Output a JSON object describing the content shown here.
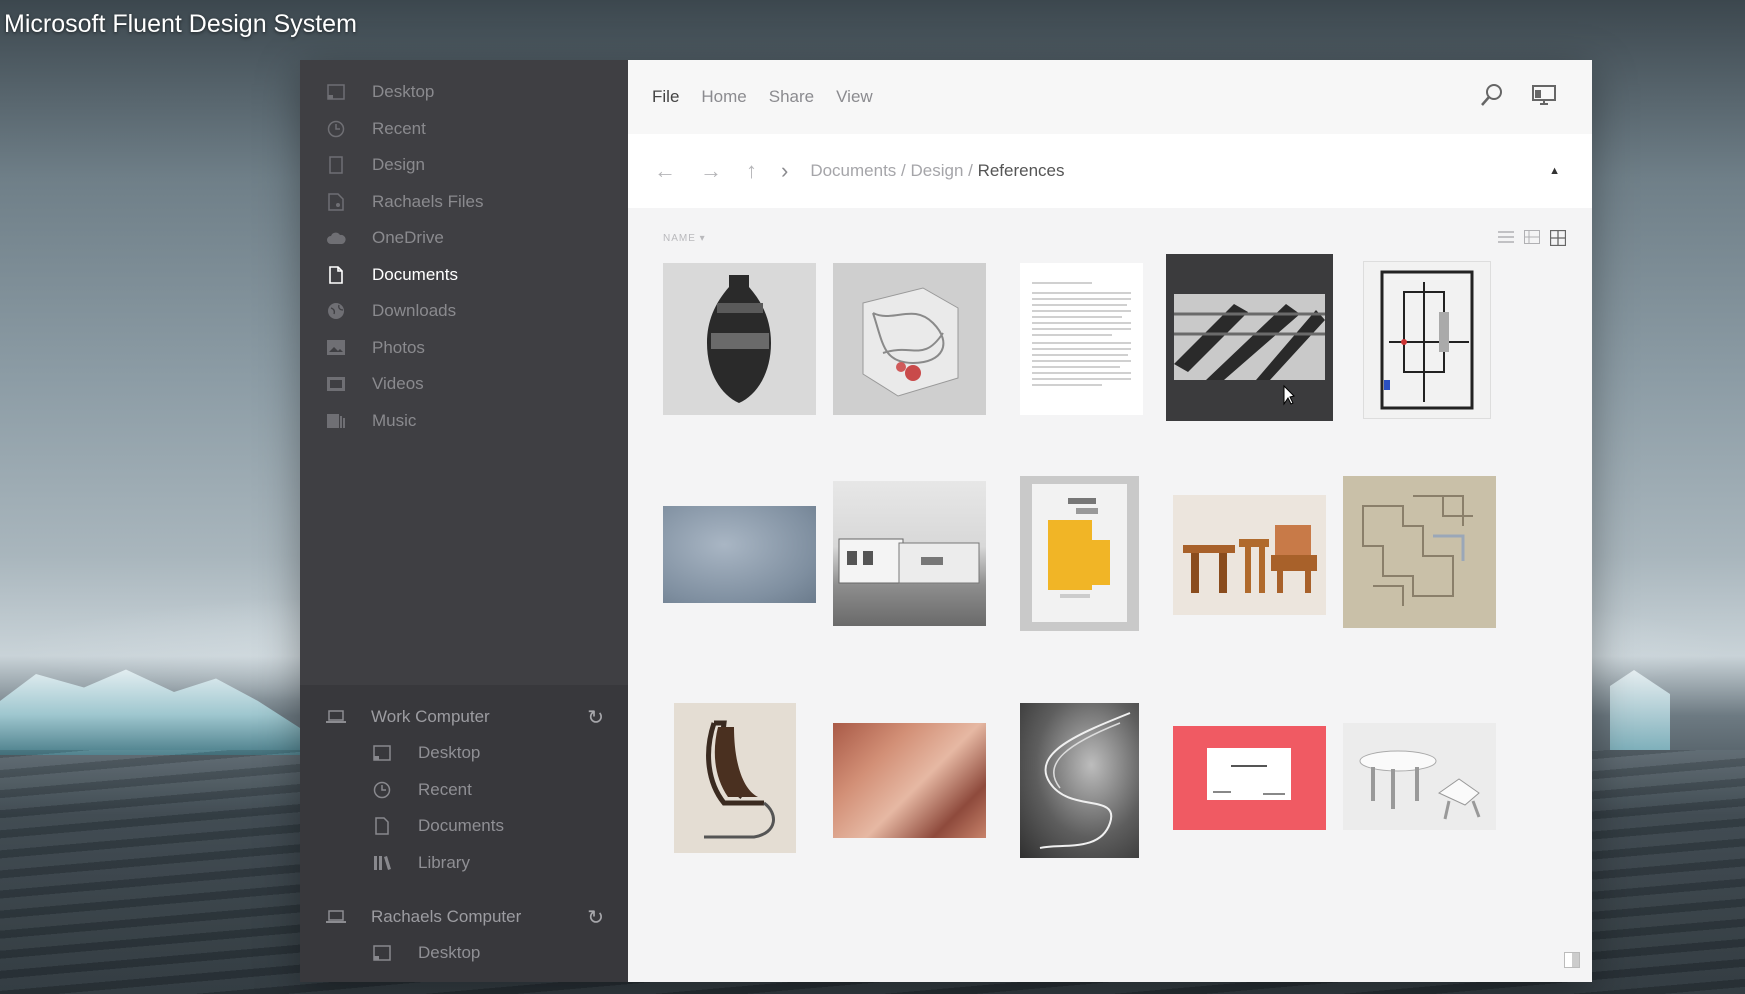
{
  "video_title": "Microsoft Fluent Design System",
  "sidebar": {
    "items": [
      {
        "label": "Desktop",
        "icon": "desktop-icon"
      },
      {
        "label": "Recent",
        "icon": "clock-icon"
      },
      {
        "label": "Design",
        "icon": "tablet-icon"
      },
      {
        "label": "Rachaels Files",
        "icon": "shared-file-icon"
      },
      {
        "label": "OneDrive",
        "icon": "cloud-icon"
      },
      {
        "label": "Documents",
        "icon": "document-icon",
        "active": true
      },
      {
        "label": "Downloads",
        "icon": "globe-icon"
      },
      {
        "label": "Photos",
        "icon": "photo-icon"
      },
      {
        "label": "Videos",
        "icon": "video-icon"
      },
      {
        "label": "Music",
        "icon": "music-icon"
      }
    ],
    "devices": [
      {
        "name": "Work Computer",
        "items": [
          "Desktop",
          "Recent",
          "Documents",
          "Library"
        ]
      },
      {
        "name": "Rachaels Computer",
        "items": [
          "Desktop"
        ]
      }
    ]
  },
  "menu": [
    "File",
    "Home",
    "Share",
    "View"
  ],
  "breadcrumb": {
    "part1": "Documents",
    "sep": " / ",
    "part2": "Design",
    "current": "References"
  },
  "sort_label": "NAME",
  "accent": "#f05a63"
}
